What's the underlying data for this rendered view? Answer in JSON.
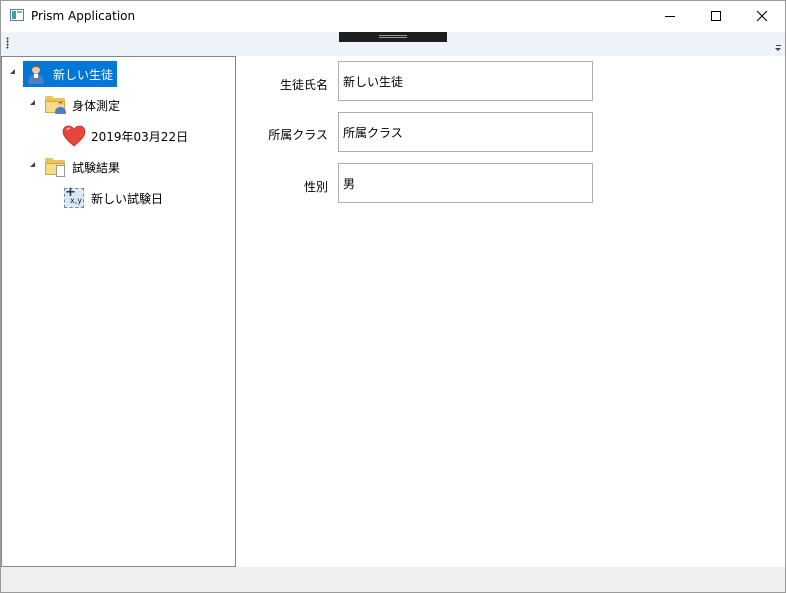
{
  "window": {
    "title": "Prism Application"
  },
  "tree": {
    "root": {
      "label": "新しい生徒",
      "icon": "student-icon",
      "selected": true,
      "expanded": true,
      "children": [
        {
          "label": "身体測定",
          "icon": "folder-person-icon",
          "expanded": true,
          "children": [
            {
              "label": "2019年03月22日",
              "icon": "heart-icon"
            }
          ]
        },
        {
          "label": "試験結果",
          "icon": "folder-document-icon",
          "expanded": true,
          "children": [
            {
              "label": "新しい試験日",
              "icon": "xy-chart-icon",
              "icon_text": "x,y"
            }
          ]
        }
      ]
    }
  },
  "form": {
    "name_label": "生徒氏名",
    "name_value": "新しい生徒",
    "class_label": "所属クラス",
    "class_value": "所属クラス",
    "gender_label": "性別",
    "gender_value": "男"
  },
  "colors": {
    "selection": "#0078d7",
    "toolbar_bg": "#eef3fa",
    "statusbar_bg": "#f0eeee"
  }
}
